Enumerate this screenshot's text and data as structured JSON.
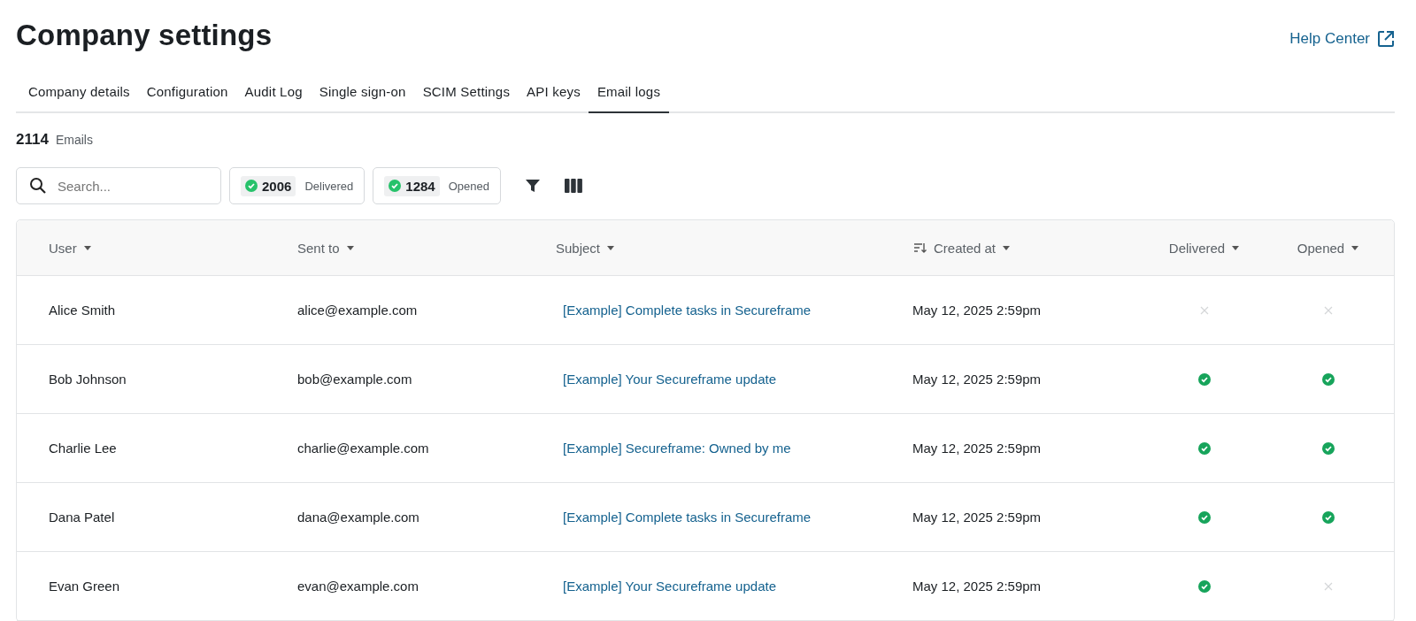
{
  "page": {
    "title": "Company settings",
    "help_link": "Help Center"
  },
  "tabs": [
    {
      "label": "Company details",
      "selected": false
    },
    {
      "label": "Configuration",
      "selected": false
    },
    {
      "label": "Audit Log",
      "selected": false
    },
    {
      "label": "Single sign-on",
      "selected": false
    },
    {
      "label": "SCIM Settings",
      "selected": false
    },
    {
      "label": "API keys",
      "selected": false
    },
    {
      "label": "Email logs",
      "selected": true
    }
  ],
  "summary": {
    "count": "2114",
    "label": "Emails"
  },
  "search": {
    "placeholder": "Search..."
  },
  "filters": [
    {
      "count": "2006",
      "label": "Delivered"
    },
    {
      "count": "1284",
      "label": "Opened"
    }
  ],
  "table": {
    "columns": [
      {
        "label": "User",
        "sorted": false
      },
      {
        "label": "Sent to",
        "sorted": false
      },
      {
        "label": "Subject",
        "sorted": false
      },
      {
        "label": "Created at",
        "sorted": true
      },
      {
        "label": "Delivered",
        "sorted": false
      },
      {
        "label": "Opened",
        "sorted": false
      }
    ],
    "rows": [
      {
        "user": "Alice Smith",
        "sent_to": "alice@example.com",
        "subject": "[Example] Complete tasks in Secureframe",
        "created_at": "May 12, 2025 2:59pm",
        "delivered": false,
        "opened": false
      },
      {
        "user": "Bob Johnson",
        "sent_to": "bob@example.com",
        "subject": "[Example] Your Secureframe update",
        "created_at": "May 12, 2025 2:59pm",
        "delivered": true,
        "opened": true
      },
      {
        "user": "Charlie Lee",
        "sent_to": "charlie@example.com",
        "subject": "[Example] Secureframe: Owned by me",
        "created_at": "May 12, 2025 2:59pm",
        "delivered": true,
        "opened": true
      },
      {
        "user": "Dana Patel",
        "sent_to": "dana@example.com",
        "subject": "[Example] Complete tasks in Secureframe",
        "created_at": "May 12, 2025 2:59pm",
        "delivered": true,
        "opened": true
      },
      {
        "user": "Evan Green",
        "sent_to": "evan@example.com",
        "subject": "[Example] Your Secureframe update",
        "created_at": "May 12, 2025 2:59pm",
        "delivered": true,
        "opened": false
      }
    ]
  }
}
